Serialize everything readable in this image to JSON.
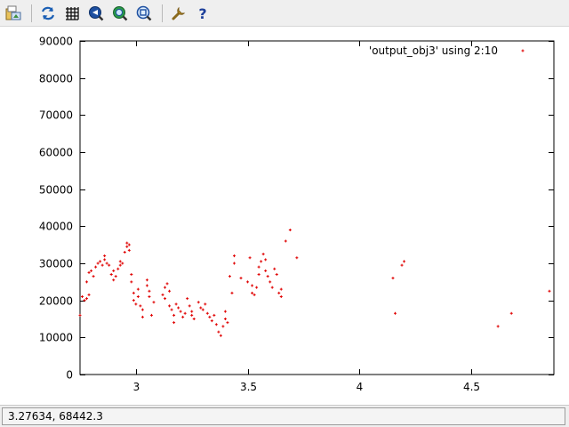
{
  "toolbar": {
    "buttons": [
      {
        "icon": "export-icon"
      },
      {
        "icon": "replot-icon"
      },
      {
        "icon": "grid-icon"
      },
      {
        "icon": "zoom-previous-icon"
      },
      {
        "icon": "zoom-next-icon"
      },
      {
        "icon": "autoscale-icon"
      },
      {
        "icon": "settings-icon"
      },
      {
        "icon": "help-icon"
      }
    ]
  },
  "status": {
    "coordinates": "3.27634,  68442.3"
  },
  "colors": {
    "series": "#e00000",
    "toolbar_bg": "#efefef"
  },
  "chart_data": {
    "type": "scatter",
    "title": "",
    "xlabel": "",
    "ylabel": "",
    "xlim": [
      2.75,
      4.87
    ],
    "ylim": [
      0,
      90000
    ],
    "xticks": [
      3,
      3.5,
      4,
      4.5
    ],
    "xtick_labels": [
      "3",
      "3.5",
      "4",
      "4.5"
    ],
    "yticks": [
      0,
      10000,
      20000,
      30000,
      40000,
      50000,
      60000,
      70000,
      80000,
      90000
    ],
    "ytick_labels": [
      "0",
      "10000",
      "20000",
      "30000",
      "40000",
      "50000",
      "60000",
      "70000",
      "80000",
      "90000"
    ],
    "grid": false,
    "legend_position": "top-right",
    "series": [
      {
        "name": "'output_obj3' using 2:10",
        "color": "#e00000",
        "marker": "plus",
        "points": [
          [
            2.75,
            16000
          ],
          [
            2.76,
            21000
          ],
          [
            2.77,
            20000
          ],
          [
            2.78,
            20500
          ],
          [
            2.79,
            21500
          ],
          [
            2.78,
            25000
          ],
          [
            2.79,
            27500
          ],
          [
            2.8,
            28000
          ],
          [
            2.81,
            26500
          ],
          [
            2.82,
            29000
          ],
          [
            2.83,
            30000
          ],
          [
            2.84,
            30500
          ],
          [
            2.85,
            29500
          ],
          [
            2.86,
            31000
          ],
          [
            2.86,
            32000
          ],
          [
            2.87,
            30000
          ],
          [
            2.88,
            29500
          ],
          [
            2.89,
            27000
          ],
          [
            2.9,
            28000
          ],
          [
            2.9,
            25500
          ],
          [
            2.91,
            26500
          ],
          [
            2.92,
            28500
          ],
          [
            2.93,
            29500
          ],
          [
            2.93,
            30500
          ],
          [
            2.94,
            30000
          ],
          [
            2.95,
            33000
          ],
          [
            2.96,
            34500
          ],
          [
            2.96,
            35500
          ],
          [
            2.97,
            33500
          ],
          [
            2.97,
            35000
          ],
          [
            2.98,
            27000
          ],
          [
            2.98,
            25000
          ],
          [
            2.99,
            22000
          ],
          [
            2.99,
            20000
          ],
          [
            3.0,
            19000
          ],
          [
            3.01,
            21000
          ],
          [
            3.01,
            23000
          ],
          [
            3.02,
            18500
          ],
          [
            3.03,
            17500
          ],
          [
            3.03,
            15500
          ],
          [
            3.05,
            25500
          ],
          [
            3.05,
            24000
          ],
          [
            3.06,
            22500
          ],
          [
            3.06,
            21000
          ],
          [
            3.07,
            16000
          ],
          [
            3.08,
            19500
          ],
          [
            3.12,
            21500
          ],
          [
            3.13,
            23500
          ],
          [
            3.13,
            20500
          ],
          [
            3.14,
            24500
          ],
          [
            3.15,
            22500
          ],
          [
            3.15,
            18500
          ],
          [
            3.16,
            17500
          ],
          [
            3.17,
            14000
          ],
          [
            3.17,
            16000
          ],
          [
            3.18,
            19000
          ],
          [
            3.19,
            18000
          ],
          [
            3.2,
            17000
          ],
          [
            3.21,
            15500
          ],
          [
            3.22,
            16500
          ],
          [
            3.23,
            20500
          ],
          [
            3.24,
            18500
          ],
          [
            3.25,
            17000
          ],
          [
            3.25,
            16000
          ],
          [
            3.26,
            15000
          ],
          [
            3.28,
            19500
          ],
          [
            3.29,
            18000
          ],
          [
            3.3,
            17500
          ],
          [
            3.31,
            19000
          ],
          [
            3.32,
            16500
          ],
          [
            3.33,
            15500
          ],
          [
            3.34,
            14500
          ],
          [
            3.35,
            16000
          ],
          [
            3.36,
            13500
          ],
          [
            3.37,
            11500
          ],
          [
            3.38,
            10500
          ],
          [
            3.39,
            13000
          ],
          [
            3.4,
            15000
          ],
          [
            3.4,
            17000
          ],
          [
            3.41,
            14000
          ],
          [
            3.42,
            26500
          ],
          [
            3.43,
            22000
          ],
          [
            3.44,
            30000
          ],
          [
            3.44,
            32000
          ],
          [
            3.47,
            26000
          ],
          [
            3.5,
            25000
          ],
          [
            3.51,
            31500
          ],
          [
            3.52,
            24000
          ],
          [
            3.52,
            22000
          ],
          [
            3.53,
            21500
          ],
          [
            3.54,
            23500
          ],
          [
            3.55,
            27000
          ],
          [
            3.55,
            29000
          ],
          [
            3.56,
            30500
          ],
          [
            3.57,
            32500
          ],
          [
            3.58,
            31000
          ],
          [
            3.58,
            28000
          ],
          [
            3.59,
            26500
          ],
          [
            3.6,
            25000
          ],
          [
            3.61,
            23500
          ],
          [
            3.62,
            28500
          ],
          [
            3.63,
            27000
          ],
          [
            3.64,
            22000
          ],
          [
            3.65,
            21000
          ],
          [
            3.65,
            23000
          ],
          [
            3.67,
            36000
          ],
          [
            3.69,
            39000
          ],
          [
            3.72,
            31500
          ],
          [
            4.15,
            26000
          ],
          [
            4.16,
            16500
          ],
          [
            4.19,
            29500
          ],
          [
            4.2,
            30500
          ],
          [
            4.62,
            13000
          ],
          [
            4.68,
            16500
          ],
          [
            4.85,
            22500
          ]
        ]
      }
    ]
  }
}
